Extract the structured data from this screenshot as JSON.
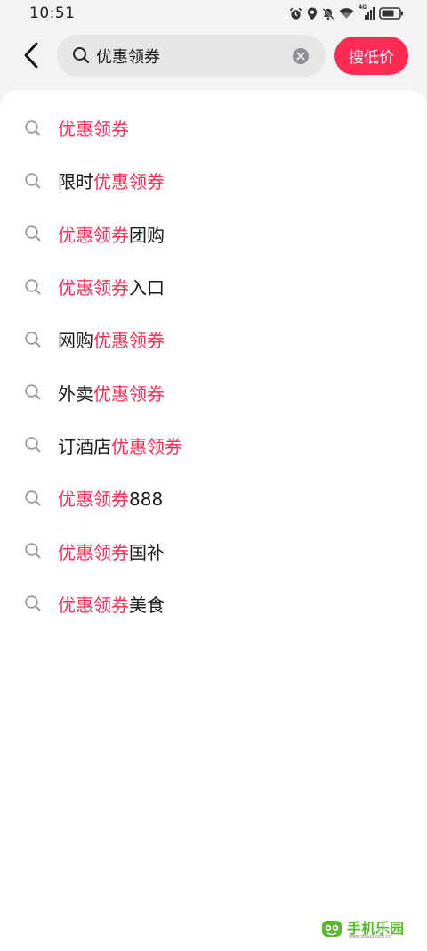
{
  "status_bar": {
    "time": "10:51",
    "network": "4G",
    "icons": [
      "alarm-icon",
      "location-icon",
      "mute-icon",
      "wifi-icon",
      "signal-icon",
      "battery-icon"
    ]
  },
  "header": {
    "back_icon": "chevron-left-icon",
    "search": {
      "value": "优惠领券",
      "placeholder": ""
    },
    "clear_icon": "clear-circle-icon",
    "submit_label": "搜低价"
  },
  "suggestions": [
    {
      "prefix": "",
      "highlight": "优惠领券",
      "suffix": ""
    },
    {
      "prefix": "限时",
      "highlight": "优惠领券",
      "suffix": ""
    },
    {
      "prefix": "",
      "highlight": "优惠领券",
      "suffix": "团购"
    },
    {
      "prefix": "",
      "highlight": "优惠领券",
      "suffix": "入口"
    },
    {
      "prefix": "网购",
      "highlight": "优惠领券",
      "suffix": ""
    },
    {
      "prefix": "外卖",
      "highlight": "优惠领券",
      "suffix": ""
    },
    {
      "prefix": "订酒店",
      "highlight": "优惠领券",
      "suffix": ""
    },
    {
      "prefix": "",
      "highlight": "优惠领券",
      "suffix": "888"
    },
    {
      "prefix": "",
      "highlight": "优惠领券",
      "suffix": "国补"
    },
    {
      "prefix": "",
      "highlight": "优惠领券",
      "suffix": "美食"
    }
  ],
  "watermark": {
    "text": "手机乐园",
    "url": "www.shouji.com.cn"
  },
  "colors": {
    "accent": "#fe2c55",
    "page_bg": "#f3f3f5",
    "panel_bg": "#ffffff",
    "search_bg": "#e6e6e9",
    "watermark_green": "#5bb82e"
  }
}
